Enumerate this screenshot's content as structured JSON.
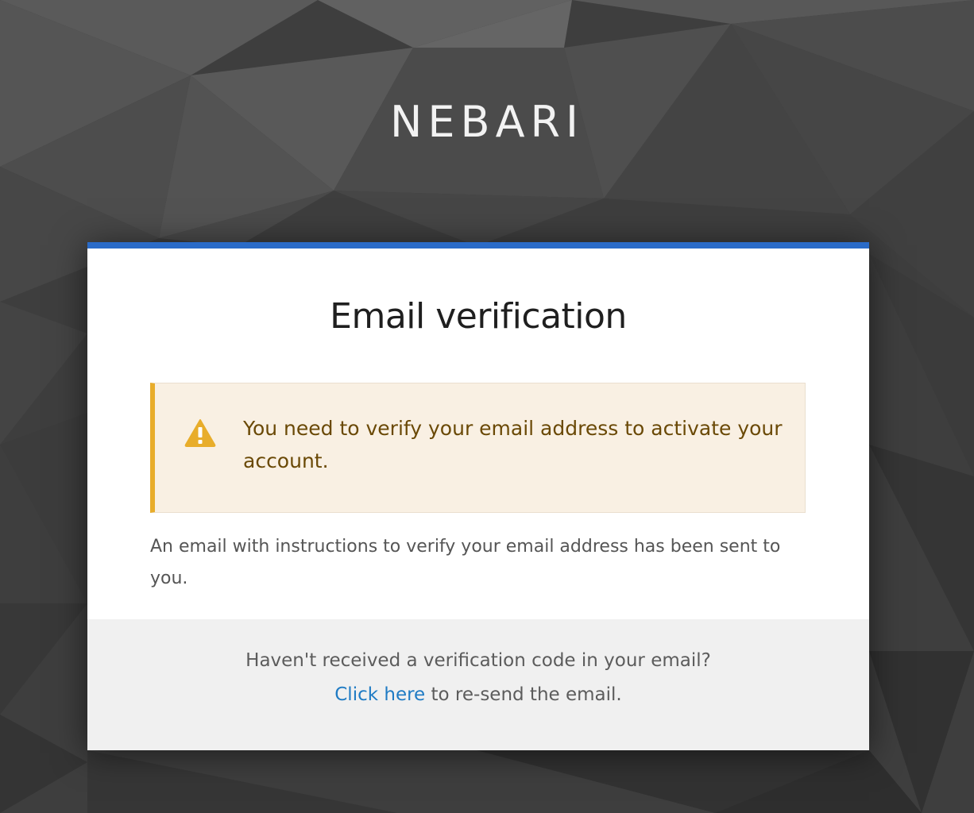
{
  "brand": {
    "name": "NEBARI"
  },
  "card": {
    "title": "Email verification",
    "accent_color": "#2a6bc8",
    "alert": {
      "type": "warning",
      "icon": "warning-triangle-icon",
      "icon_color": "#e8ad2b",
      "message": "You need to verify your email address to activate your account."
    },
    "info_text": "An email with instructions to verify your email address has been sent to you.",
    "footer": {
      "question": "Haven't received a verification code in your email?",
      "link_label": "Click here",
      "link_suffix": " to re-send the email.",
      "link_color": "#1f7bc4"
    }
  }
}
